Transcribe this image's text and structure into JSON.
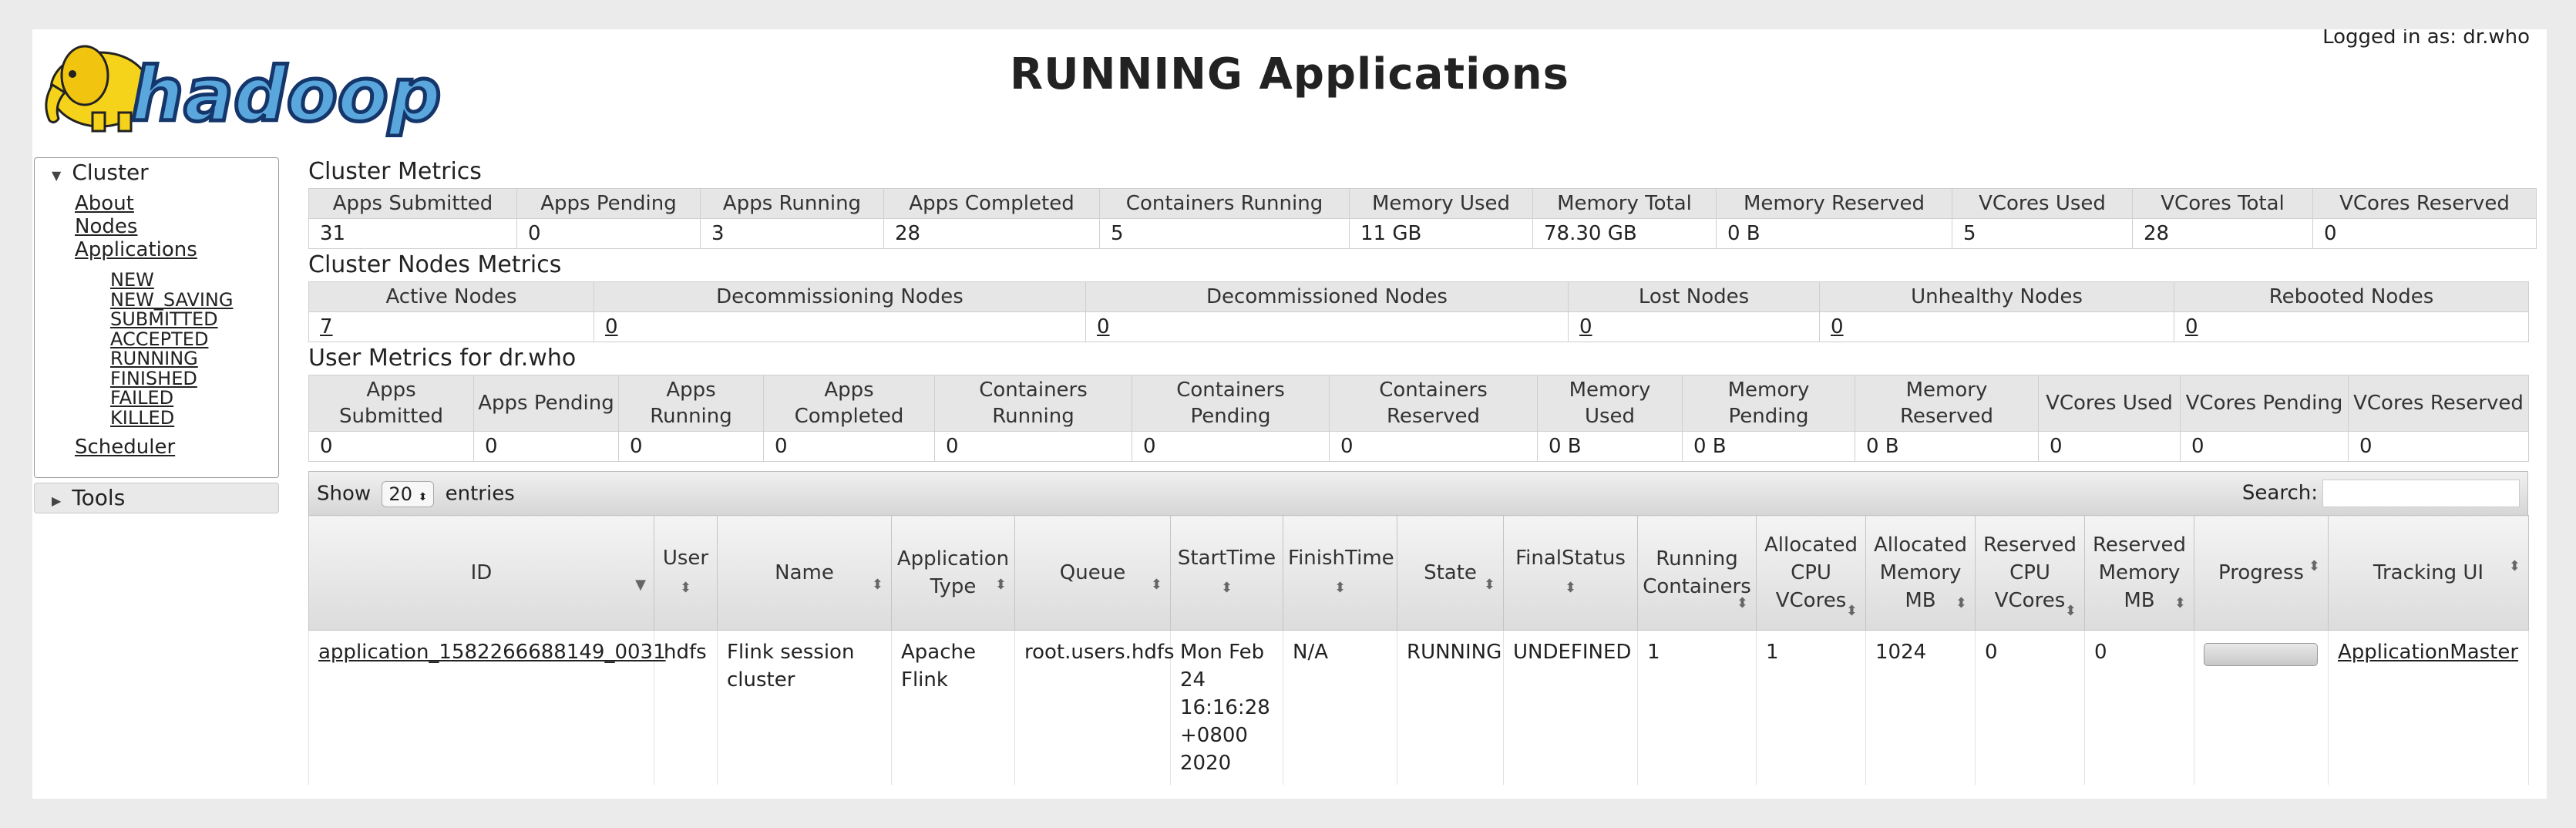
{
  "header": {
    "title": "RUNNING Applications",
    "logged_in": "Logged in as: dr.who",
    "logo_text": "hadoop"
  },
  "sidebar": {
    "cluster_label": "Cluster",
    "cluster_items": [
      "About",
      "Nodes",
      "Applications"
    ],
    "app_states": [
      "NEW",
      "NEW_SAVING",
      "SUBMITTED",
      "ACCEPTED",
      "RUNNING",
      "FINISHED",
      "FAILED",
      "KILLED"
    ],
    "scheduler": "Scheduler",
    "tools_label": "Tools"
  },
  "cluster_metrics": {
    "title": "Cluster Metrics",
    "headers": [
      "Apps Submitted",
      "Apps Pending",
      "Apps Running",
      "Apps Completed",
      "Containers Running",
      "Memory Used",
      "Memory Total",
      "Memory Reserved",
      "VCores Used",
      "VCores Total",
      "VCores Reserved"
    ],
    "values": [
      "31",
      "0",
      "3",
      "28",
      "5",
      "11 GB",
      "78.30 GB",
      "0 B",
      "5",
      "28",
      "0"
    ]
  },
  "nodes_metrics": {
    "title": "Cluster Nodes Metrics",
    "headers": [
      "Active Nodes",
      "Decommissioning Nodes",
      "Decommissioned Nodes",
      "Lost Nodes",
      "Unhealthy Nodes",
      "Rebooted Nodes"
    ],
    "values": [
      "7",
      "0",
      "0",
      "0",
      "0",
      "0"
    ]
  },
  "user_metrics": {
    "title": "User Metrics for dr.who",
    "headers": [
      "Apps Submitted",
      "Apps Pending",
      "Apps Running",
      "Apps Completed",
      "Containers Running",
      "Containers Pending",
      "Containers Reserved",
      "Memory Used",
      "Memory Pending",
      "Memory Reserved",
      "VCores Used",
      "VCores Pending",
      "VCores Reserved"
    ],
    "values": [
      "0",
      "0",
      "0",
      "0",
      "0",
      "0",
      "0",
      "0 B",
      "0 B",
      "0 B",
      "0",
      "0",
      "0"
    ]
  },
  "apps_table": {
    "show_label": "Show",
    "entries_value": "20",
    "entries_label": "entries",
    "search_label": "Search:",
    "headers": [
      "ID",
      "User",
      "Name",
      "Application Type",
      "Queue",
      "StartTime",
      "FinishTime",
      "State",
      "FinalStatus",
      "Running Containers",
      "Allocated CPU VCores",
      "Allocated Memory MB",
      "Reserved CPU VCores",
      "Reserved Memory MB",
      "Progress",
      "Tracking UI"
    ],
    "rows": [
      {
        "id": "application_1582266688149_0031",
        "user": "hdfs",
        "name": "Flink session cluster",
        "type": "Apache Flink",
        "queue": "root.users.hdfs",
        "start": "Mon Feb 24 16:16:28 +0800 2020",
        "finish": "N/A",
        "state": "RUNNING",
        "final_status": "UNDEFINED",
        "running_containers": "1",
        "alloc_vcores": "1",
        "alloc_mem": "1024",
        "res_vcores": "0",
        "res_mem": "0",
        "progress": 0,
        "tracking": "ApplicationMaster"
      }
    ]
  }
}
